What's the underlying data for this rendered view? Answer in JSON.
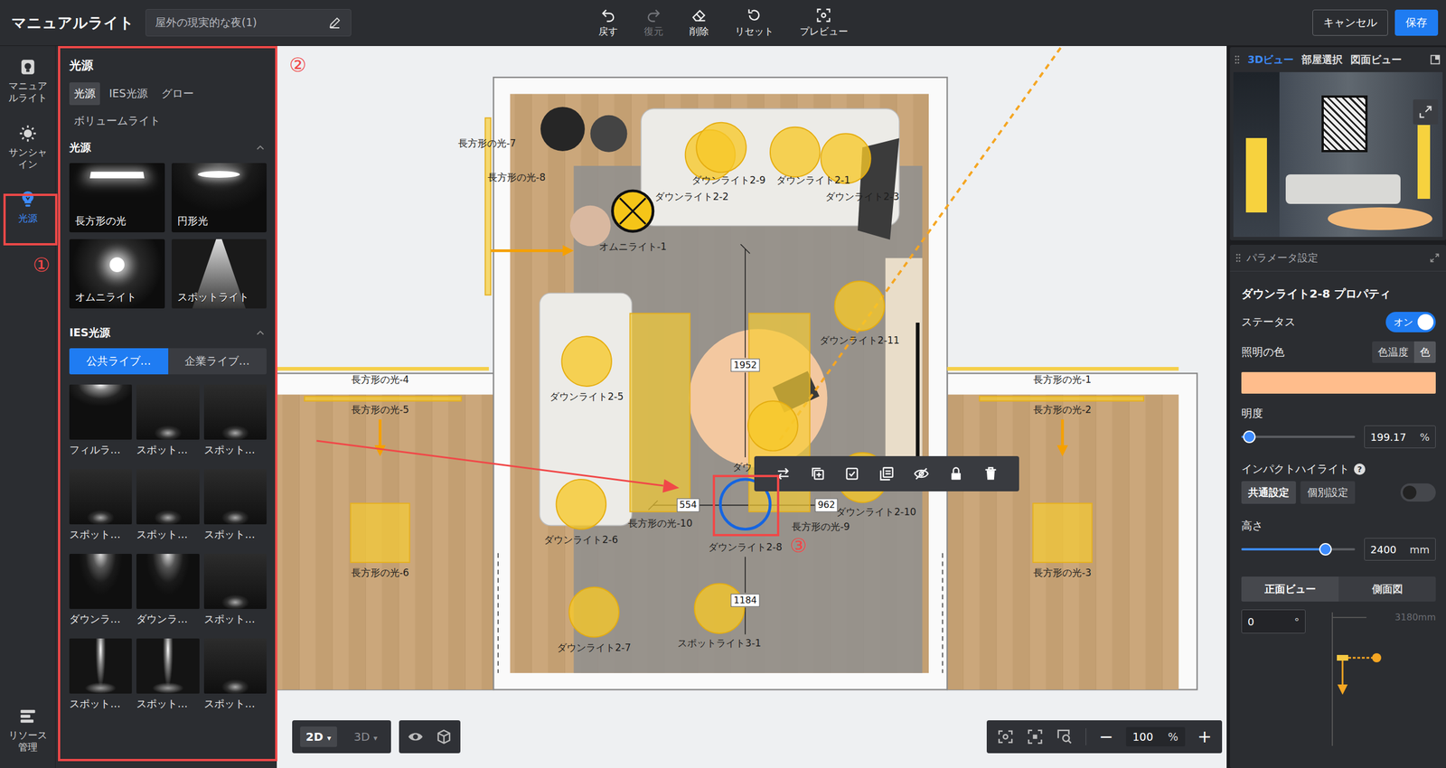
{
  "app": {
    "title": "マニュアルライト",
    "scene_name": "屋外の現実的な夜(1)"
  },
  "toolbar": [
    {
      "label": "戻す",
      "kind": "undo",
      "disabled": false
    },
    {
      "label": "復元",
      "kind": "redo",
      "disabled": true
    },
    {
      "label": "削除",
      "kind": "erase",
      "disabled": false
    },
    {
      "label": "リセット",
      "kind": "reset",
      "disabled": false
    },
    {
      "label": "プレビュー",
      "kind": "preview",
      "disabled": false
    }
  ],
  "actions": [
    {
      "label": "キャンセル",
      "kind": "secondary"
    },
    {
      "label": "保存",
      "kind": "primary"
    }
  ],
  "rail": {
    "items": [
      {
        "label": "マニュアルライト",
        "kind": "manual",
        "selected": false
      },
      {
        "label": "サンシャイン",
        "kind": "sun",
        "selected": false
      },
      {
        "label": "光源",
        "kind": "light",
        "selected": true
      }
    ],
    "footer": {
      "label": "リソース管理"
    }
  },
  "library": {
    "title": "光源",
    "tabs": [
      {
        "label": "光源",
        "selected": true
      },
      {
        "label": "IES光源",
        "selected": false
      },
      {
        "label": "グロー",
        "selected": false
      },
      {
        "label": "ボリュームライト",
        "selected": false
      }
    ],
    "basic": {
      "title": "光源",
      "expanded": true,
      "items": [
        {
          "label": "長方形の光",
          "kind": "rect"
        },
        {
          "label": "円形光",
          "kind": "circle"
        },
        {
          "label": "オムニライト",
          "kind": "omni"
        },
        {
          "label": "スポットライト",
          "kind": "spot"
        }
      ]
    },
    "ies": {
      "title": "IES光源",
      "expanded": true,
      "sources": [
        {
          "label": "公共ライブ…",
          "selected": true
        },
        {
          "label": "企業ライブ…",
          "selected": false
        }
      ],
      "items": [
        {
          "label": "フィルラ…",
          "kind": "fill"
        },
        {
          "label": "スポット…",
          "kind": "spot"
        },
        {
          "label": "スポット…",
          "kind": "spot"
        },
        {
          "label": "スポット…",
          "kind": "spot"
        },
        {
          "label": "スポット…",
          "kind": "spot"
        },
        {
          "label": "スポット…",
          "kind": "spot"
        },
        {
          "label": "ダウンラ…",
          "kind": "down"
        },
        {
          "label": "ダウンラ…",
          "kind": "down"
        },
        {
          "label": "スポット…",
          "kind": "spot"
        },
        {
          "label": "スポット…",
          "kind": "beam"
        },
        {
          "label": "スポット…",
          "kind": "beam"
        },
        {
          "label": "スポット…",
          "kind": "spot"
        }
      ]
    }
  },
  "plan": {
    "lights": [
      {
        "label": "長方形の光-7",
        "kind": "rect",
        "selected": false
      },
      {
        "label": "長方形の光-8",
        "kind": "rect",
        "selected": false
      },
      {
        "label": "ダウンライト2-2",
        "kind": "downlight",
        "selected": false
      },
      {
        "label": "ダウンライト2-9",
        "kind": "downlight",
        "selected": false
      },
      {
        "label": "ダウンライト2-1",
        "kind": "downlight",
        "selected": false
      },
      {
        "label": "ダウンライト2-3",
        "kind": "downlight",
        "selected": false
      },
      {
        "label": "オムニライト-1",
        "kind": "omni",
        "selected": false
      },
      {
        "label": "ダウンライト2-11",
        "kind": "downlight",
        "selected": false
      },
      {
        "label": "ダウンライト2-5",
        "kind": "downlight",
        "selected": false
      },
      {
        "label": "長方形の光-4",
        "kind": "rect",
        "selected": false
      },
      {
        "label": "長方形の光-5",
        "kind": "rect",
        "selected": false
      },
      {
        "label": "長方形の光-1",
        "kind": "rect",
        "selected": false
      },
      {
        "label": "長方形の光-2",
        "kind": "rect",
        "selected": false
      },
      {
        "label": "長方形の光-6",
        "kind": "rect",
        "selected": false
      },
      {
        "label": "長方形の光-3",
        "kind": "rect",
        "selected": false
      },
      {
        "label": "長方形の光-10",
        "kind": "rect",
        "selected": false
      },
      {
        "label": "長方形の光-9",
        "kind": "rect",
        "selected": false
      },
      {
        "label": "ダウンライト2-6",
        "kind": "downlight",
        "selected": false
      },
      {
        "label": "ダウンライト2-8",
        "kind": "downlight",
        "selected": true
      },
      {
        "label": "ダウンライト2-10",
        "kind": "downlight",
        "selected": false
      },
      {
        "label": "ダウンライト2-7",
        "kind": "downlight",
        "selected": false
      },
      {
        "label": "スポットライト3-1",
        "kind": "spot",
        "selected": false
      },
      {
        "label": "ダウ",
        "kind": "downlight",
        "selected": false
      }
    ],
    "dimensions": [
      "1952",
      "554",
      "962",
      "1184"
    ]
  },
  "view_controls": {
    "modes": [
      {
        "label": "2D",
        "selected": true
      },
      {
        "label": "3D",
        "selected": false
      }
    ],
    "caret": "▾",
    "zoom": "100",
    "unit": "%",
    "minus": "−",
    "plus": "+"
  },
  "view_panel": {
    "tabs": [
      {
        "label": "3Dビュー",
        "selected": true
      },
      {
        "label": "部屋選択",
        "selected": false
      },
      {
        "label": "図面ビュー",
        "selected": false
      }
    ]
  },
  "properties": {
    "header": "パラメータ設定",
    "title": "ダウンライト2-8 プロパティ",
    "status": {
      "label": "ステータス",
      "on": true,
      "text": "オン"
    },
    "color": {
      "label": "照明の色",
      "modes": [
        {
          "label": "色温度",
          "selected": false
        },
        {
          "label": "色",
          "selected": true
        }
      ],
      "value": "#ffbd8c"
    },
    "brightness": {
      "label": "明度",
      "level": 0.07,
      "value": "199.17",
      "unit": "%"
    },
    "highlight": {
      "label": "インパクトハイライト",
      "help": "?",
      "modes": [
        {
          "label": "共通設定",
          "selected": true
        },
        {
          "label": "個別設定",
          "selected": false
        }
      ],
      "on": false
    },
    "height": {
      "label": "高さ",
      "level": 0.74,
      "value": "2400",
      "unit": "mm"
    },
    "views": [
      {
        "label": "正面ビュー",
        "selected": true
      },
      {
        "label": "側面図",
        "selected": false
      }
    ],
    "angle": {
      "value": "0",
      "unit": "°"
    },
    "span": "3180mm"
  },
  "annotations": [
    {
      "label": "①"
    },
    {
      "label": "②"
    },
    {
      "label": "③"
    }
  ]
}
